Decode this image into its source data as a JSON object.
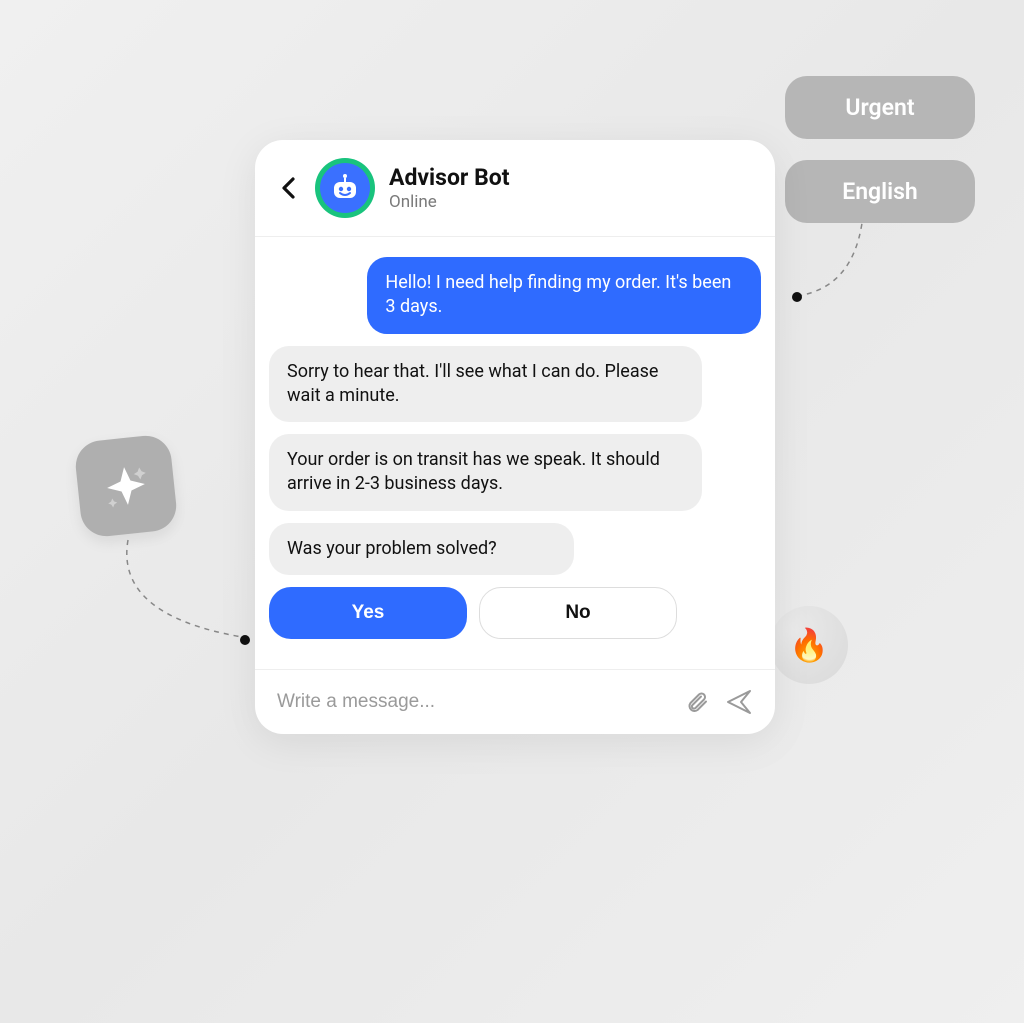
{
  "header": {
    "bot_name": "Advisor Bot",
    "status": "Online"
  },
  "messages": {
    "user_1": "Hello! I need help finding my order. It's been 3 days.",
    "bot_1": "Sorry to hear that. I'll see what I can do. Please wait a minute.",
    "bot_2": "Your order is on transit has we speak. It should arrive in 2-3 business days.",
    "bot_3": "Was your problem solved?"
  },
  "quick_replies": {
    "yes": "Yes",
    "no": "No"
  },
  "input": {
    "placeholder": "Write a message..."
  },
  "tags": {
    "urgent": "Urgent",
    "english": "English"
  },
  "badges": {
    "fire_emoji": "🔥"
  },
  "colors": {
    "accent": "#2F6BFF",
    "avatar_ring": "#19C37D"
  }
}
